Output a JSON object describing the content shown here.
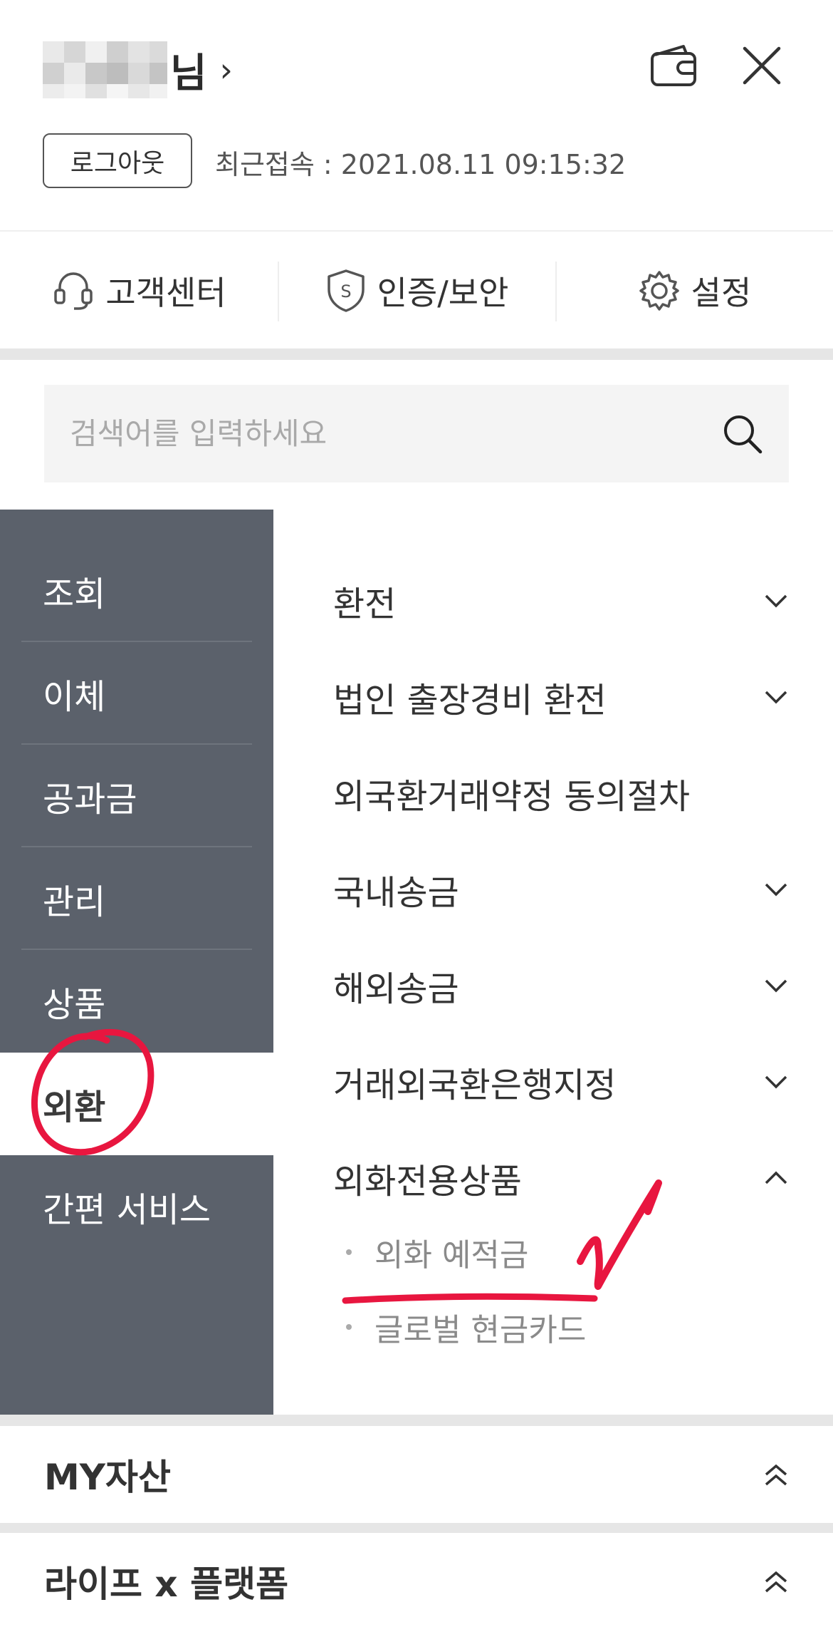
{
  "header": {
    "user_suffix": "님",
    "chevron": "›",
    "logout_label": "로그아웃",
    "last_login": "최근접속 : 2021.08.11 09:15:32"
  },
  "quick_menu": [
    {
      "label": "고객센터",
      "icon": "headset-icon"
    },
    {
      "label": "인증/보안",
      "icon": "shield-icon"
    },
    {
      "label": "설정",
      "icon": "gear-icon"
    }
  ],
  "search": {
    "placeholder": "검색어를 입력하세요",
    "icon": "search-icon"
  },
  "left_nav": {
    "items": [
      {
        "label": "조회"
      },
      {
        "label": "이체"
      },
      {
        "label": "공과금"
      },
      {
        "label": "관리"
      },
      {
        "label": "상품"
      },
      {
        "label": "외환",
        "active": true
      },
      {
        "label": "간편 서비스"
      }
    ]
  },
  "submenu": {
    "items": [
      {
        "label": "환전",
        "expandable": true,
        "expanded": false
      },
      {
        "label": "법인 출장경비 환전",
        "expandable": true,
        "expanded": false
      },
      {
        "label": "외국환거래약정 동의절차",
        "expandable": false
      },
      {
        "label": "국내송금",
        "expandable": true,
        "expanded": false
      },
      {
        "label": "해외송금",
        "expandable": true,
        "expanded": false
      },
      {
        "label": "거래외국환은행지정",
        "expandable": true,
        "expanded": false
      },
      {
        "label": "외화전용상품",
        "expandable": true,
        "expanded": true
      }
    ],
    "children": [
      {
        "label": "외화 예적금"
      },
      {
        "label": "글로벌 현금카드"
      }
    ]
  },
  "sections": [
    {
      "title": "MY자산",
      "icon": "double-chevron-up-icon"
    },
    {
      "title": "라이프 x 플랫폼",
      "icon": "double-chevron-up-icon"
    }
  ],
  "colors": {
    "nav_bg": "#5b616b",
    "band": "#e6e6e6",
    "annotation": "#e8163f"
  }
}
